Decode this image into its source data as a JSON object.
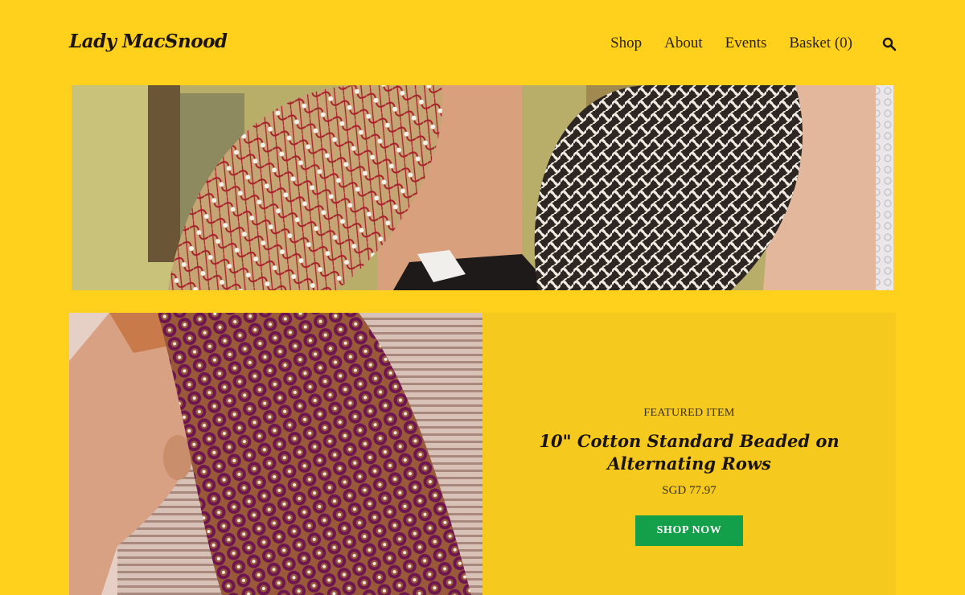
{
  "header": {
    "logo": "Lady MacSnood",
    "nav": [
      "Shop",
      "About",
      "Events",
      "Basket (0)"
    ],
    "search_icon": "search-icon"
  },
  "hero": {
    "image": "banner-snoods-photo"
  },
  "featured": {
    "image": "featured-snood-photo",
    "label": "FEATURED ITEM",
    "title": "10\" Cotton Standard Beaded on Alternating Rows",
    "price": "SGD 77.97",
    "button": "SHOP NOW"
  },
  "colors": {
    "page_background": "#FFD11D",
    "panel_background": "#F6C91F",
    "button_background": "#14A04A"
  }
}
